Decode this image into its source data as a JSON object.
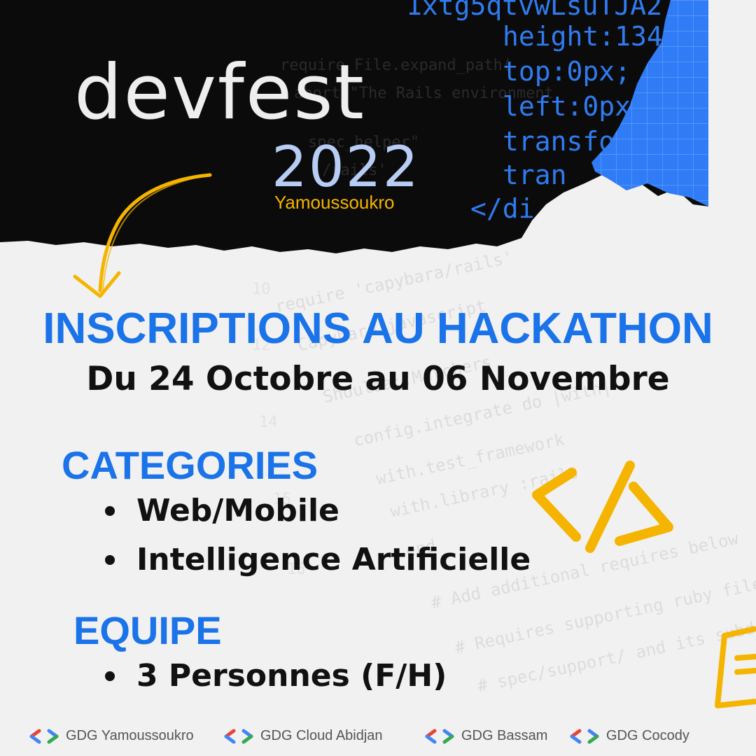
{
  "header": {
    "code_lines": [
      "1xtg5qtvwLsuTJA2",
      "height:134",
      "top:0px;",
      "left:0px",
      "transfo",
      "tran",
      "</di"
    ],
    "logo_word": "devfest",
    "logo_year": "2022",
    "logo_city": "Yamoussoukro"
  },
  "main": {
    "title": "INSCRIPTIONS AU HACKATHON",
    "dates": "Du 24 Octobre au 06 Novembre"
  },
  "categories": {
    "title": "CATEGORIES",
    "items": [
      "Web/Mobile",
      "Intelligence Artificielle"
    ]
  },
  "team": {
    "title": "EQUIPE",
    "items": [
      "3 Personnes (F/H)"
    ]
  },
  "footer": {
    "chapters": [
      "GDG Yamoussoukro",
      "GDG Cloud Abidjan",
      "GDG Bassam",
      "GDG Cocody"
    ]
  },
  "colors": {
    "blue": "#1a73e8",
    "yellow": "#f5b400",
    "dark": "#0b0b0b",
    "google_red": "#ea4335",
    "google_blue": "#4285f4",
    "google_green": "#34a853"
  }
}
